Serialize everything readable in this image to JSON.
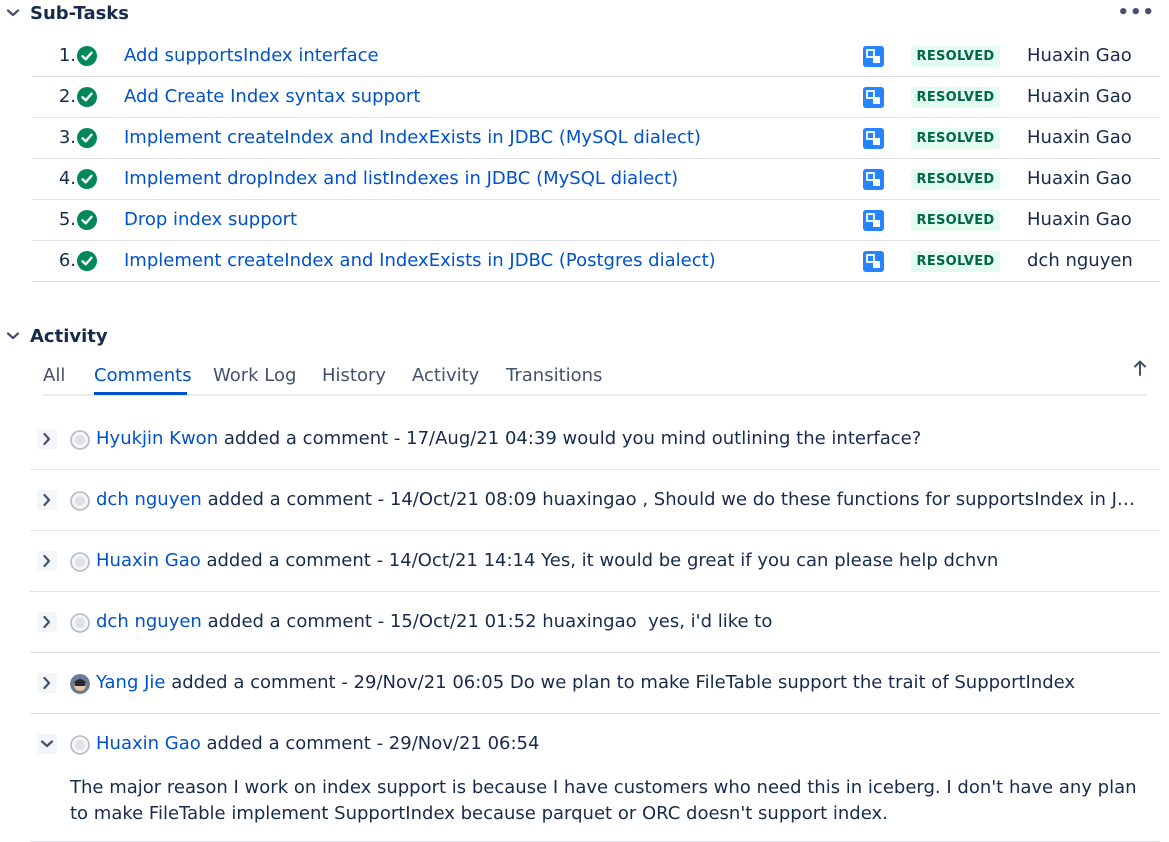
{
  "subtasks": {
    "title": "Sub-Tasks",
    "more": "•••",
    "items": [
      {
        "num": "1.",
        "title": "Add supportsIndex interface",
        "status": "RESOLVED",
        "assignee": "Huaxin Gao"
      },
      {
        "num": "2.",
        "title": "Add Create Index syntax support",
        "status": "RESOLVED",
        "assignee": "Huaxin Gao"
      },
      {
        "num": "3.",
        "title": "Implement createIndex and IndexExists in JDBC (MySQL dialect)",
        "status": "RESOLVED",
        "assignee": "Huaxin Gao"
      },
      {
        "num": "4.",
        "title": "Implement dropIndex and listIndexes in JDBC (MySQL dialect)",
        "status": "RESOLVED",
        "assignee": "Huaxin Gao"
      },
      {
        "num": "5.",
        "title": "Drop index support",
        "status": "RESOLVED",
        "assignee": "Huaxin Gao"
      },
      {
        "num": "6.",
        "title": "Implement createIndex and IndexExists in JDBC (Postgres dialect)",
        "status": "RESOLVED",
        "assignee": "dch nguyen"
      }
    ]
  },
  "activity": {
    "title": "Activity",
    "tabs": [
      "All",
      "Comments",
      "Work Log",
      "History",
      "Activity",
      "Transitions"
    ],
    "active_tab": "Comments"
  },
  "comments": [
    {
      "author": "Hyukjin Kwon",
      "meta": " added a comment - 17/Aug/21 04:39 ",
      "text": "would you mind outlining the interface?",
      "expanded": false
    },
    {
      "author": "dch nguyen",
      "meta": " added a comment - 14/Oct/21 08:09 ",
      "text": "huaxingao , Should we do these functions for supportsIndex in JDBC for this ticket or a separate ticket?",
      "expanded": false
    },
    {
      "author": "Huaxin Gao",
      "meta": " added a comment - 14/Oct/21 14:14 ",
      "text": "Yes, it would be great if you can please help dchvn",
      "expanded": false
    },
    {
      "author": "dch nguyen",
      "meta": " added a comment - 15/Oct/21 01:52 ",
      "text": "huaxingao  yes, i'd like to",
      "expanded": false
    },
    {
      "author": "Yang Jie",
      "meta": " added a comment - 29/Nov/21 06:05 ",
      "text": "Do we plan to make FileTable support the trait of SupportIndex",
      "expanded": false
    },
    {
      "author": "Huaxin Gao",
      "meta": " added a comment - 29/Nov/21 06:54",
      "text": "",
      "expanded": true,
      "body": "The major reason I work on index support is because I have customers who need this in iceberg. I don't have any plan to make FileTable implement SupportIndex because parquet or ORC doesn't support index."
    }
  ],
  "colors": {
    "link": "#0052cc",
    "resolved_bg": "#e3fcef",
    "resolved_text": "#006644",
    "check": "#00875a",
    "type_icon": "#2684ff"
  }
}
